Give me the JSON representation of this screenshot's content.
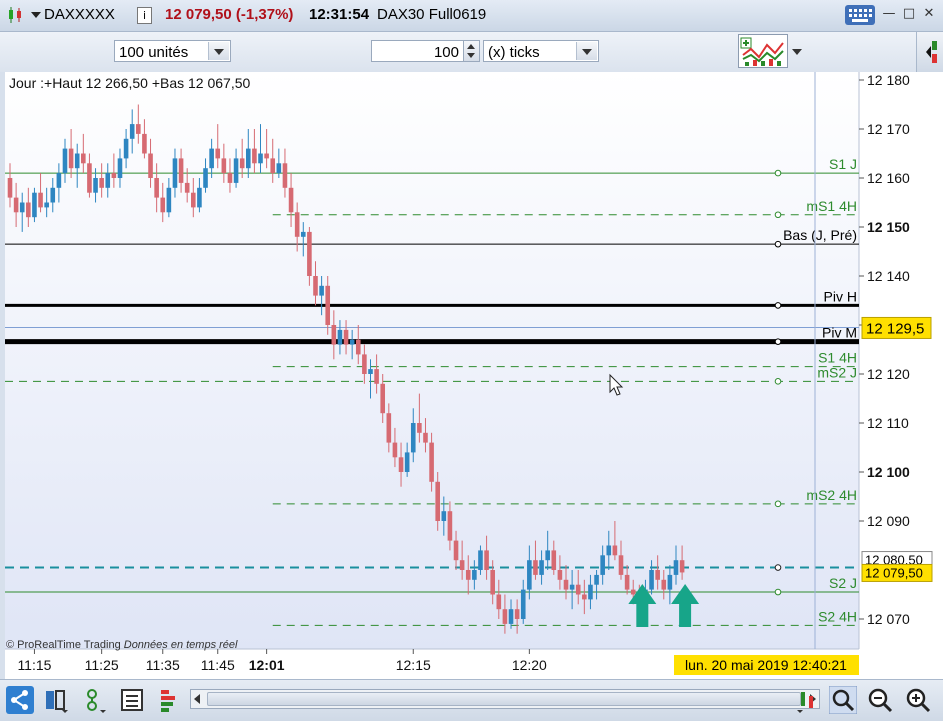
{
  "header": {
    "instrument": "DAXXXXX",
    "info_label": "i",
    "last_price": "12 079,50 (-1,37%)",
    "clock": "12:31:54",
    "instrument_full": "DAX30 Full0619"
  },
  "toolbar": {
    "units_value": "100 unités",
    "ticks_value": "100",
    "ticks_unit": "(x) ticks"
  },
  "colors": {
    "bullish": "#2e86c1",
    "bearish": "#d66a72",
    "support": "#2e8b2e",
    "pivot": "#000000",
    "cursor_line": "#1a8f9e",
    "price_tag": "#ffe000",
    "arrow": "#17a589"
  },
  "chart_data": {
    "type": "candlestick",
    "info_text": "Jour :+Haut 12 266,50 +Bas 12 067,50",
    "copyright": "© ProRealTime Trading",
    "realtime_note": "Données en temps réel",
    "y_ticks": [
      {
        "v": 12180,
        "label": "12 180",
        "bold": false
      },
      {
        "v": 12170,
        "label": "12 170",
        "bold": false
      },
      {
        "v": 12160,
        "label": "12 160",
        "bold": false
      },
      {
        "v": 12150,
        "label": "12 150",
        "bold": true
      },
      {
        "v": 12140,
        "label": "12 140",
        "bold": false
      },
      {
        "v": 12130,
        "label": "12 130",
        "bold": false
      },
      {
        "v": 12120,
        "label": "12 120",
        "bold": false
      },
      {
        "v": 12110,
        "label": "12 110",
        "bold": false
      },
      {
        "v": 12100,
        "label": "12 100",
        "bold": true
      },
      {
        "v": 12090,
        "label": "12 090",
        "bold": false
      },
      {
        "v": 12070,
        "label": "12 070",
        "bold": false
      }
    ],
    "x_ticks": [
      {
        "i": 4,
        "label": "11:15",
        "bold": false
      },
      {
        "i": 15,
        "label": "11:25",
        "bold": false
      },
      {
        "i": 25,
        "label": "11:35",
        "bold": false
      },
      {
        "i": 34,
        "label": "11:45",
        "bold": false
      },
      {
        "i": 42,
        "label": "12:01",
        "bold": true
      },
      {
        "i": 66,
        "label": "12:15",
        "bold": false
      },
      {
        "i": 85,
        "label": "12:20",
        "bold": false
      }
    ],
    "date_label": "lun. 20 mai 2019 12:40:21",
    "levels": [
      {
        "label": "S1 J",
        "value": 12161,
        "style": "solid",
        "color": "#2e8b2e",
        "width": 1,
        "x0": 0,
        "marker": true
      },
      {
        "label": "mS1 4H",
        "value": 12152.5,
        "style": "dashed",
        "color": "#2e8b2e",
        "width": 1,
        "x0": 43,
        "marker": true
      },
      {
        "label": "Bas (J, Pré)",
        "value": 12146.5,
        "style": "solid",
        "color": "#000000",
        "width": 1,
        "x0": 0,
        "marker": true
      },
      {
        "label": "Piv H",
        "value": 12134,
        "style": "solid",
        "color": "#000000",
        "width": 3,
        "x0": 0,
        "marker": true
      },
      {
        "label": "",
        "value": 12129.5,
        "style": "solid",
        "color": "#7f9fd4",
        "width": 1,
        "x0": 0,
        "marker": false
      },
      {
        "label": "Piv M",
        "value": 12126.6,
        "style": "solid",
        "color": "#000000",
        "width": 5,
        "x0": 0,
        "marker": true
      },
      {
        "label": "S1 4H",
        "value": 12121.5,
        "style": "dashed",
        "color": "#2e8b2e",
        "width": 1,
        "x0": 43,
        "marker": false
      },
      {
        "label": "mS2 J",
        "value": 12118.5,
        "style": "dashed",
        "color": "#2e8b2e",
        "width": 1,
        "x0": 0,
        "marker": true
      },
      {
        "label": "mS2 4H",
        "value": 12093.5,
        "style": "dashed",
        "color": "#2e8b2e",
        "width": 1,
        "x0": 43,
        "marker": true
      },
      {
        "label": "S2 J",
        "value": 12075.5,
        "style": "solid",
        "color": "#2e8b2e",
        "width": 1,
        "x0": 0,
        "marker": true
      },
      {
        "label": "S2 4H",
        "value": 12068.7,
        "style": "dashed",
        "color": "#2e8b2e",
        "width": 1,
        "x0": 43,
        "marker": false
      }
    ],
    "current_price": {
      "value": 12079.5,
      "label": "12 079,50"
    },
    "cursor_price": {
      "value": 12080.5,
      "label": "12 080,50"
    },
    "highlight_price": {
      "value": 12129.5,
      "label": "12 129,5"
    },
    "arrows_at": [
      103,
      110
    ],
    "candles": [
      {
        "o": 12160,
        "h": 12163,
        "l": 12154,
        "c": 12156
      },
      {
        "o": 12156,
        "h": 12159,
        "l": 12150,
        "c": 12153
      },
      {
        "o": 12153,
        "h": 12157,
        "l": 12149,
        "c": 12155
      },
      {
        "o": 12155,
        "h": 12158,
        "l": 12150,
        "c": 12152
      },
      {
        "o": 12152,
        "h": 12158,
        "l": 12151,
        "c": 12157
      },
      {
        "o": 12157,
        "h": 12161,
        "l": 12153,
        "c": 12154
      },
      {
        "o": 12154,
        "h": 12158,
        "l": 12152,
        "c": 12155
      },
      {
        "o": 12155,
        "h": 12160,
        "l": 12153,
        "c": 12158
      },
      {
        "o": 12158,
        "h": 12163,
        "l": 12155,
        "c": 12161
      },
      {
        "o": 12161,
        "h": 12168,
        "l": 12159,
        "c": 12166
      },
      {
        "o": 12166,
        "h": 12170,
        "l": 12160,
        "c": 12162
      },
      {
        "o": 12162,
        "h": 12167,
        "l": 12158,
        "c": 12165
      },
      {
        "o": 12165,
        "h": 12169,
        "l": 12161,
        "c": 12163
      },
      {
        "o": 12163,
        "h": 12165,
        "l": 12156,
        "c": 12157
      },
      {
        "o": 12157,
        "h": 12162,
        "l": 12155,
        "c": 12160
      },
      {
        "o": 12160,
        "h": 12163,
        "l": 12156,
        "c": 12158
      },
      {
        "o": 12158,
        "h": 12163,
        "l": 12156,
        "c": 12161
      },
      {
        "o": 12161,
        "h": 12165,
        "l": 12158,
        "c": 12160
      },
      {
        "o": 12160,
        "h": 12166,
        "l": 12158,
        "c": 12164
      },
      {
        "o": 12164,
        "h": 12170,
        "l": 12162,
        "c": 12168
      },
      {
        "o": 12168,
        "h": 12174,
        "l": 12165,
        "c": 12171
      },
      {
        "o": 12171,
        "h": 12175,
        "l": 12167,
        "c": 12169
      },
      {
        "o": 12169,
        "h": 12172,
        "l": 12164,
        "c": 12165
      },
      {
        "o": 12165,
        "h": 12168,
        "l": 12158,
        "c": 12160
      },
      {
        "o": 12160,
        "h": 12163,
        "l": 12153,
        "c": 12156
      },
      {
        "o": 12156,
        "h": 12159,
        "l": 12151,
        "c": 12153
      },
      {
        "o": 12153,
        "h": 12160,
        "l": 12152,
        "c": 12158
      },
      {
        "o": 12158,
        "h": 12166,
        "l": 12156,
        "c": 12164
      },
      {
        "o": 12164,
        "h": 12166,
        "l": 12157,
        "c": 12159
      },
      {
        "o": 12159,
        "h": 12162,
        "l": 12155,
        "c": 12157
      },
      {
        "o": 12157,
        "h": 12160,
        "l": 12152,
        "c": 12154
      },
      {
        "o": 12154,
        "h": 12160,
        "l": 12153,
        "c": 12158
      },
      {
        "o": 12158,
        "h": 12164,
        "l": 12157,
        "c": 12162
      },
      {
        "o": 12162,
        "h": 12168,
        "l": 12160,
        "c": 12166
      },
      {
        "o": 12166,
        "h": 12171,
        "l": 12162,
        "c": 12164
      },
      {
        "o": 12164,
        "h": 12167,
        "l": 12159,
        "c": 12161
      },
      {
        "o": 12161,
        "h": 12164,
        "l": 12157,
        "c": 12159
      },
      {
        "o": 12159,
        "h": 12166,
        "l": 12158,
        "c": 12164
      },
      {
        "o": 12164,
        "h": 12168,
        "l": 12160,
        "c": 12162
      },
      {
        "o": 12162,
        "h": 12170,
        "l": 12160,
        "c": 12166
      },
      {
        "o": 12166,
        "h": 12170,
        "l": 12161,
        "c": 12163
      },
      {
        "o": 12163,
        "h": 12171,
        "l": 12161,
        "c": 12165
      },
      {
        "o": 12165,
        "h": 12170,
        "l": 12162,
        "c": 12164
      },
      {
        "o": 12164,
        "h": 12168,
        "l": 12159,
        "c": 12161
      },
      {
        "o": 12161,
        "h": 12166,
        "l": 12160,
        "c": 12163
      },
      {
        "o": 12163,
        "h": 12166,
        "l": 12156,
        "c": 12158
      },
      {
        "o": 12158,
        "h": 12161,
        "l": 12150,
        "c": 12153
      },
      {
        "o": 12153,
        "h": 12155,
        "l": 12145,
        "c": 12148
      },
      {
        "o": 12148,
        "h": 12151,
        "l": 12144,
        "c": 12149
      },
      {
        "o": 12149,
        "h": 12150,
        "l": 12138,
        "c": 12140
      },
      {
        "o": 12140,
        "h": 12143,
        "l": 12134,
        "c": 12136
      },
      {
        "o": 12136,
        "h": 12140,
        "l": 12132,
        "c": 12138
      },
      {
        "o": 12138,
        "h": 12140,
        "l": 12128,
        "c": 12130
      },
      {
        "o": 12130,
        "h": 12133,
        "l": 12123,
        "c": 12126
      },
      {
        "o": 12126,
        "h": 12131,
        "l": 12124,
        "c": 12129
      },
      {
        "o": 12129,
        "h": 12131,
        "l": 12124,
        "c": 12126
      },
      {
        "o": 12126,
        "h": 12129,
        "l": 12123,
        "c": 12127
      },
      {
        "o": 12127,
        "h": 12130,
        "l": 12122,
        "c": 12124
      },
      {
        "o": 12124,
        "h": 12126,
        "l": 12118,
        "c": 12120
      },
      {
        "o": 12120,
        "h": 12123,
        "l": 12115,
        "c": 12121
      },
      {
        "o": 12121,
        "h": 12124,
        "l": 12116,
        "c": 12118
      },
      {
        "o": 12118,
        "h": 12120,
        "l": 12110,
        "c": 12112
      },
      {
        "o": 12112,
        "h": 12114,
        "l": 12104,
        "c": 12106
      },
      {
        "o": 12106,
        "h": 12109,
        "l": 12101,
        "c": 12103
      },
      {
        "o": 12103,
        "h": 12106,
        "l": 12097,
        "c": 12100
      },
      {
        "o": 12100,
        "h": 12106,
        "l": 12099,
        "c": 12104
      },
      {
        "o": 12104,
        "h": 12113,
        "l": 12102,
        "c": 12110
      },
      {
        "o": 12110,
        "h": 12116,
        "l": 12106,
        "c": 12108
      },
      {
        "o": 12108,
        "h": 12111,
        "l": 12104,
        "c": 12106
      },
      {
        "o": 12106,
        "h": 12108,
        "l": 12096,
        "c": 12098
      },
      {
        "o": 12098,
        "h": 12100,
        "l": 12088,
        "c": 12090
      },
      {
        "o": 12090,
        "h": 12095,
        "l": 12087,
        "c": 12092
      },
      {
        "o": 12092,
        "h": 12094,
        "l": 12084,
        "c": 12086
      },
      {
        "o": 12086,
        "h": 12088,
        "l": 12080,
        "c": 12082
      },
      {
        "o": 12082,
        "h": 12086,
        "l": 12078,
        "c": 12080
      },
      {
        "o": 12080,
        "h": 12083,
        "l": 12075,
        "c": 12078
      },
      {
        "o": 12078,
        "h": 12082,
        "l": 12076,
        "c": 12080
      },
      {
        "o": 12080,
        "h": 12085,
        "l": 12079,
        "c": 12084
      },
      {
        "o": 12084,
        "h": 12087,
        "l": 12078,
        "c": 12080
      },
      {
        "o": 12080,
        "h": 12082,
        "l": 12073,
        "c": 12075
      },
      {
        "o": 12075,
        "h": 12078,
        "l": 12070,
        "c": 12072
      },
      {
        "o": 12072,
        "h": 12075,
        "l": 12067,
        "c": 12069
      },
      {
        "o": 12069,
        "h": 12074,
        "l": 12068,
        "c": 12072
      },
      {
        "o": 12072,
        "h": 12074,
        "l": 12067,
        "c": 12070
      },
      {
        "o": 12070,
        "h": 12078,
        "l": 12069,
        "c": 12076
      },
      {
        "o": 12076,
        "h": 12085,
        "l": 12074,
        "c": 12082
      },
      {
        "o": 12082,
        "h": 12086,
        "l": 12078,
        "c": 12079
      },
      {
        "o": 12079,
        "h": 12084,
        "l": 12077,
        "c": 12082
      },
      {
        "o": 12082,
        "h": 12088,
        "l": 12080,
        "c": 12084
      },
      {
        "o": 12084,
        "h": 12086,
        "l": 12079,
        "c": 12080
      },
      {
        "o": 12080,
        "h": 12083,
        "l": 12076,
        "c": 12078
      },
      {
        "o": 12078,
        "h": 12081,
        "l": 12074,
        "c": 12076
      },
      {
        "o": 12076,
        "h": 12080,
        "l": 12072,
        "c": 12077
      },
      {
        "o": 12077,
        "h": 12080,
        "l": 12073,
        "c": 12075
      },
      {
        "o": 12075,
        "h": 12078,
        "l": 12071,
        "c": 12074
      },
      {
        "o": 12074,
        "h": 12079,
        "l": 12072,
        "c": 12077
      },
      {
        "o": 12077,
        "h": 12080,
        "l": 12074,
        "c": 12079
      },
      {
        "o": 12079,
        "h": 12085,
        "l": 12077,
        "c": 12083
      },
      {
        "o": 12083,
        "h": 12088,
        "l": 12080,
        "c": 12085
      },
      {
        "o": 12085,
        "h": 12090,
        "l": 12082,
        "c": 12083
      },
      {
        "o": 12083,
        "h": 12086,
        "l": 12078,
        "c": 12079
      },
      {
        "o": 12079,
        "h": 12081,
        "l": 12075,
        "c": 12076
      },
      {
        "o": 12076,
        "h": 12078,
        "l": 12073,
        "c": 12075
      },
      {
        "o": 12075,
        "h": 12077,
        "l": 12072,
        "c": 12074
      },
      {
        "o": 12074,
        "h": 12078,
        "l": 12071,
        "c": 12076
      },
      {
        "o": 12076,
        "h": 12082,
        "l": 12075,
        "c": 12080
      },
      {
        "o": 12080,
        "h": 12083,
        "l": 12076,
        "c": 12078
      },
      {
        "o": 12078,
        "h": 12080,
        "l": 12074,
        "c": 12076
      },
      {
        "o": 12076,
        "h": 12081,
        "l": 12073,
        "c": 12079
      },
      {
        "o": 12079,
        "h": 12085,
        "l": 12077,
        "c": 12082
      },
      {
        "o": 12082,
        "h": 12085,
        "l": 12078,
        "c": 12079.5
      }
    ]
  }
}
